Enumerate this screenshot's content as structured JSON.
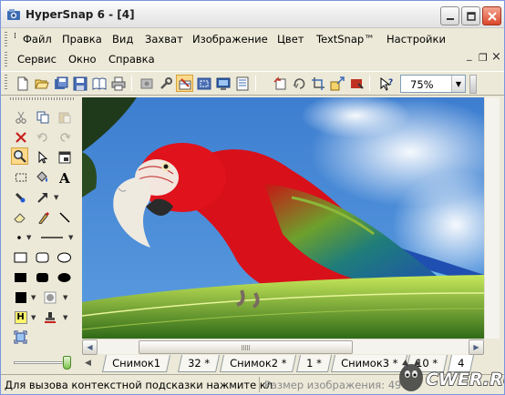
{
  "window": {
    "title": "HyperSnap 6 - [4]"
  },
  "menubar": {
    "items": [
      "Файл",
      "Правка",
      "Вид",
      "Захват",
      "Изображение",
      "Цвет",
      "TextSnap™",
      "Настройки"
    ],
    "items_row2": [
      "Сервис",
      "Окно",
      "Справка"
    ],
    "mdi_minimize": "_",
    "mdi_restore": "❐",
    "mdi_close": "×"
  },
  "toolbar": {
    "zoom_value": "75%",
    "icons": [
      "new-icon",
      "open-icon",
      "save-all-icon",
      "save-icon",
      "book-icon",
      "print-icon",
      "capture-window-icon",
      "settings-icon",
      "hand-snap-icon",
      "capture-region-icon",
      "capture-screen-icon",
      "capture-scroll-icon",
      "undo-capture-icon",
      "redo-capture-icon",
      "crop-icon",
      "resize-icon",
      "highlight-icon",
      "help-pointer-icon"
    ]
  },
  "palette": {
    "icons": [
      "cut-icon",
      "copy-icon",
      "paste-icon",
      "delete-icon",
      "undo-icon",
      "redo-icon",
      "zoom-icon",
      "pointer-icon",
      "window-icon",
      "select-rect-icon",
      "fill-icon",
      "text-icon",
      "stamp-icon",
      "arrow-tool-icon",
      "eraser-icon",
      "pen-icon",
      "line-icon",
      "point-icon",
      "line-style-icon",
      "rect-icon",
      "rounded-rect-icon",
      "ellipse-icon",
      "filled-rect-icon",
      "filled-rounded-rect-icon",
      "filled-ellipse-icon",
      "color-black-icon",
      "color-gray-icon",
      "highlight-h-icon",
      "stamp-red-icon",
      "fit-view-icon"
    ],
    "highlight_letter": "H"
  },
  "tabs": [
    "Снимок1",
    "32 *",
    "Снимок2 *",
    "1 *",
    "Снимок3 *",
    "10 *",
    "4"
  ],
  "status": {
    "hint": "Для вызова контекстной подсказки нажмите кл",
    "size_label": "Размер изображения: 49"
  },
  "watermark": {
    "text": "CWER.RU"
  },
  "colors": {
    "accent_tool": "#FFD98A",
    "close_button": "#D9462B",
    "sky": "#4E8DD8",
    "parrot_red": "#D8101A"
  }
}
